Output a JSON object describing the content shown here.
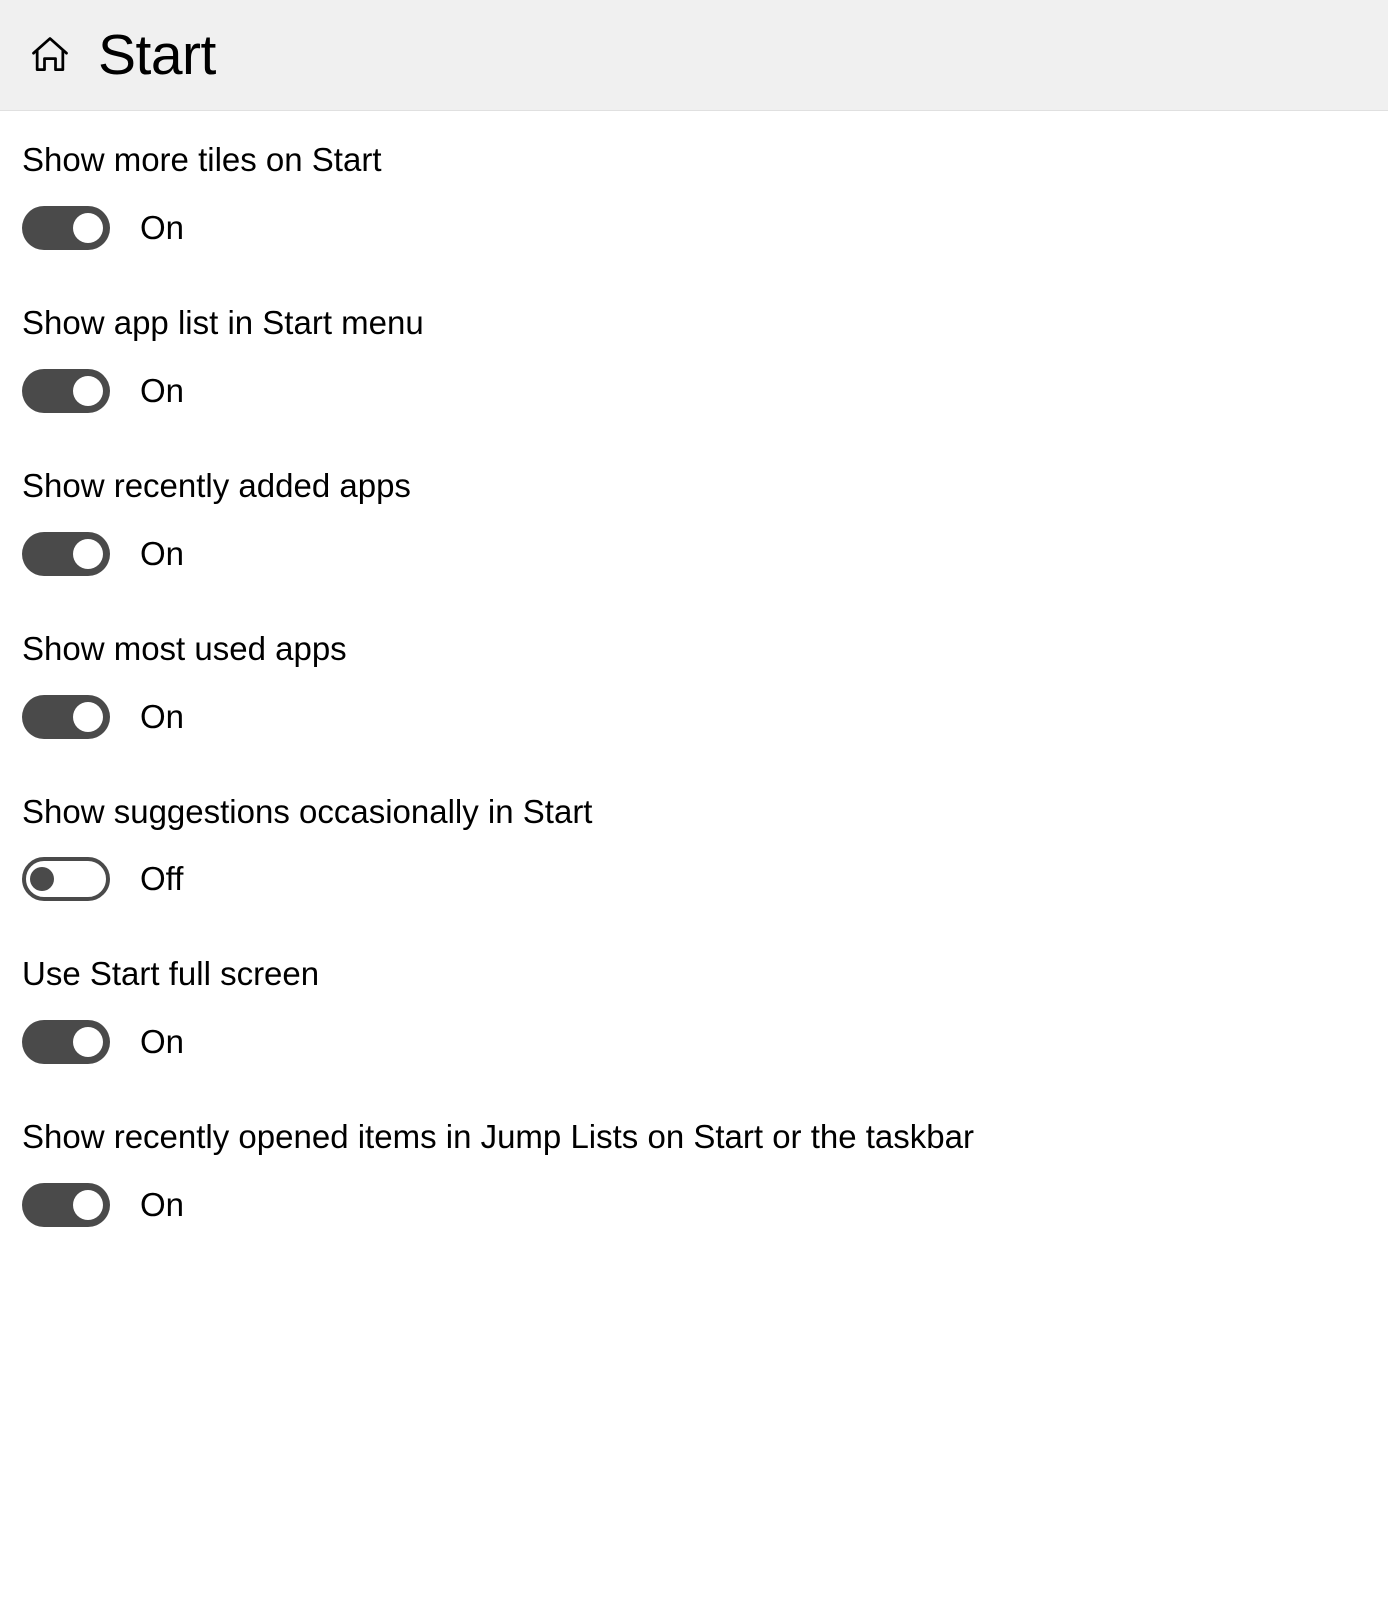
{
  "header": {
    "title": "Start"
  },
  "settings": [
    {
      "label": "Show more tiles on Start",
      "state": "on",
      "stateText": "On"
    },
    {
      "label": "Show app list in Start menu",
      "state": "on",
      "stateText": "On"
    },
    {
      "label": "Show recently added apps",
      "state": "on",
      "stateText": "On"
    },
    {
      "label": "Show most used apps",
      "state": "on",
      "stateText": "On"
    },
    {
      "label": "Show suggestions occasionally in Start",
      "state": "off",
      "stateText": "Off"
    },
    {
      "label": "Use Start full screen",
      "state": "on",
      "stateText": "On"
    },
    {
      "label": "Show recently opened items in Jump Lists on Start or the taskbar",
      "state": "on",
      "stateText": "On"
    }
  ]
}
